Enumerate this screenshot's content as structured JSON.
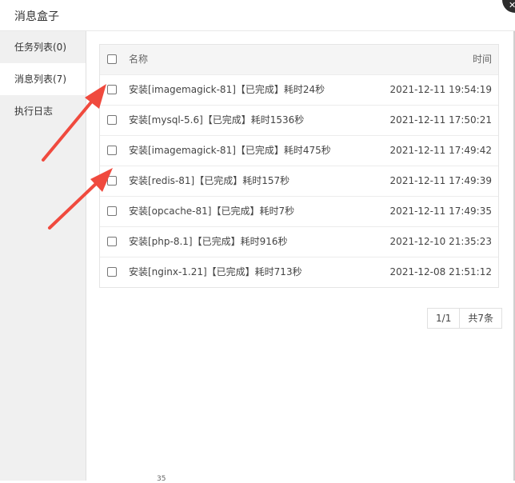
{
  "dialog": {
    "title": "消息盒子",
    "close_symbol": "✕"
  },
  "sidebar": {
    "items": [
      {
        "label": "任务列表(0)",
        "active": false
      },
      {
        "label": "消息列表(7)",
        "active": true
      },
      {
        "label": "执行日志",
        "active": false
      }
    ]
  },
  "table": {
    "headers": {
      "name": "名称",
      "time": "时间"
    },
    "rows": [
      {
        "name": "安装[imagemagick-81]【已完成】耗时24秒",
        "time": "2021-12-11 19:54:19"
      },
      {
        "name": "安装[mysql-5.6]【已完成】耗时1536秒",
        "time": "2021-12-11 17:50:21"
      },
      {
        "name": "安装[imagemagick-81]【已完成】耗时475秒",
        "time": "2021-12-11 17:49:42"
      },
      {
        "name": "安装[redis-81]【已完成】耗时157秒",
        "time": "2021-12-11 17:49:39"
      },
      {
        "name": "安装[opcache-81]【已完成】耗时7秒",
        "time": "2021-12-11 17:49:35"
      },
      {
        "name": "安装[php-8.1]【已完成】耗时916秒",
        "time": "2021-12-10 21:35:23"
      },
      {
        "name": "安装[nginx-1.21]【已完成】耗时713秒",
        "time": "2021-12-08 21:51:12"
      }
    ]
  },
  "pager": {
    "current": "1/1",
    "total": "共7条"
  },
  "background": {
    "partial_text": "35"
  },
  "colors": {
    "annotation_arrow": "#f04a3e",
    "sidebar_bg": "#f0f0f0",
    "header_bg": "#f5f5f5"
  }
}
